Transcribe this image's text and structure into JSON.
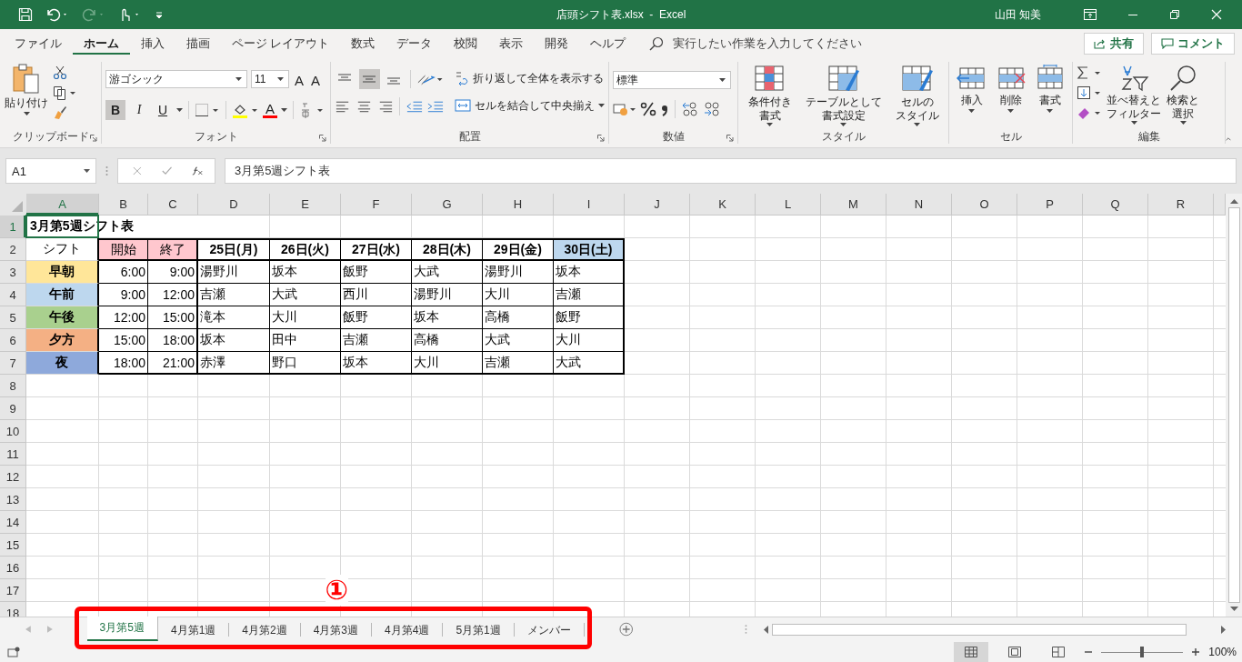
{
  "title_bar": {
    "title": "店頭シフト表.xlsx  -  Excel",
    "user": "山田 知美"
  },
  "menu_tabs": [
    {
      "label": "ファイル",
      "selected": false
    },
    {
      "label": "ホーム",
      "selected": true
    },
    {
      "label": "挿入",
      "selected": false
    },
    {
      "label": "描画",
      "selected": false
    },
    {
      "label": "ページ レイアウト",
      "selected": false
    },
    {
      "label": "数式",
      "selected": false
    },
    {
      "label": "データ",
      "selected": false
    },
    {
      "label": "校閲",
      "selected": false
    },
    {
      "label": "表示",
      "selected": false
    },
    {
      "label": "開発",
      "selected": false
    },
    {
      "label": "ヘルプ",
      "selected": false
    }
  ],
  "tell_me": {
    "placeholder": "実行したい作業を入力してください"
  },
  "share_button": "共有",
  "comment_button": "コメント",
  "ribbon": {
    "clipboard": {
      "paste": "貼り付け",
      "label": "クリップボード"
    },
    "font": {
      "name": "游ゴシック",
      "size": "11",
      "size_buttons": [
        "A",
        "A"
      ],
      "styles": [
        {
          "label": "B",
          "selected": true
        },
        {
          "label": "I",
          "selected": false
        },
        {
          "label": "U",
          "selected": false
        }
      ],
      "font_color": "A",
      "label": "フォント"
    },
    "alignment": {
      "vertical": [
        {
          "selected": false
        },
        {
          "selected": true
        },
        {
          "selected": false
        }
      ],
      "wrap": "折り返して全体を表示する",
      "merge": "セルを結合して中央揃え",
      "label": "配置"
    },
    "number": {
      "format": "標準",
      "label": "数値"
    },
    "styles": {
      "buttons": [
        {
          "lines": [
            "条件付き",
            "書式"
          ]
        },
        {
          "lines": [
            "テーブルとして",
            "書式設定"
          ]
        },
        {
          "lines": [
            "セルの",
            "スタイル"
          ]
        }
      ],
      "label": "スタイル"
    },
    "cells": {
      "buttons": [
        "挿入",
        "削除",
        "書式"
      ],
      "label": "セル"
    },
    "editing": {
      "buttons": [
        {
          "lines": [
            "並べ替えと",
            "フィルター"
          ]
        },
        {
          "lines": [
            "検索と",
            "選択"
          ]
        }
      ],
      "label": "編集"
    }
  },
  "formula_bar": {
    "name_box": "A1",
    "formula": "3月第5週シフト表"
  },
  "sheet": {
    "columns": [
      {
        "label": "A",
        "selected": true
      },
      {
        "label": "B",
        "selected": false
      },
      {
        "label": "C",
        "selected": false
      },
      {
        "label": "D",
        "selected": false
      },
      {
        "label": "E",
        "selected": false
      },
      {
        "label": "F",
        "selected": false
      },
      {
        "label": "G",
        "selected": false
      },
      {
        "label": "H",
        "selected": false
      },
      {
        "label": "I",
        "selected": false
      },
      {
        "label": "J",
        "selected": false
      },
      {
        "label": "K",
        "selected": false
      },
      {
        "label": "L",
        "selected": false
      },
      {
        "label": "M",
        "selected": false
      },
      {
        "label": "N",
        "selected": false
      },
      {
        "label": "O",
        "selected": false
      },
      {
        "label": "P",
        "selected": false
      },
      {
        "label": "Q",
        "selected": false
      },
      {
        "label": "R",
        "selected": false
      }
    ],
    "rows": [
      {
        "number": "1",
        "selected": true,
        "cells": [
          {
            "kind": "title",
            "text": "3月第5週シフト表"
          }
        ]
      },
      {
        "number": "2",
        "selected": false,
        "cells": [
          {
            "kind": "label",
            "text": "シフト"
          },
          {
            "kind": "time-header",
            "text": "開始",
            "color": "#ffc7ce"
          },
          {
            "kind": "time-header",
            "text": "終了",
            "color": "#ffc7ce"
          },
          {
            "kind": "day",
            "text": "25日(月)"
          },
          {
            "kind": "day",
            "text": "26日(火)"
          },
          {
            "kind": "day",
            "text": "27日(水)"
          },
          {
            "kind": "day",
            "text": "28日(木)"
          },
          {
            "kind": "day",
            "text": "29日(金)"
          },
          {
            "kind": "day",
            "text": "30日(土)",
            "color": "#bdd7ee"
          }
        ]
      },
      {
        "number": "3",
        "selected": false,
        "cells": [
          {
            "kind": "shift",
            "text": "早朝",
            "color": "#ffe699"
          },
          {
            "kind": "time",
            "text": "6:00"
          },
          {
            "kind": "time",
            "text": "9:00"
          },
          {
            "kind": "name",
            "text": "湯野川"
          },
          {
            "kind": "name",
            "text": "坂本"
          },
          {
            "kind": "name",
            "text": "飯野"
          },
          {
            "kind": "name",
            "text": "大武"
          },
          {
            "kind": "name",
            "text": "湯野川"
          },
          {
            "kind": "name",
            "text": "坂本"
          }
        ]
      },
      {
        "number": "4",
        "selected": false,
        "cells": [
          {
            "kind": "shift",
            "text": "午前",
            "color": "#bdd7ee"
          },
          {
            "kind": "time",
            "text": "9:00"
          },
          {
            "kind": "time",
            "text": "12:00"
          },
          {
            "kind": "name",
            "text": "吉瀬"
          },
          {
            "kind": "name",
            "text": "大武"
          },
          {
            "kind": "name",
            "text": "西川"
          },
          {
            "kind": "name",
            "text": "湯野川"
          },
          {
            "kind": "name",
            "text": "大川"
          },
          {
            "kind": "name",
            "text": "吉瀬"
          }
        ]
      },
      {
        "number": "5",
        "selected": false,
        "cells": [
          {
            "kind": "shift",
            "text": "午後",
            "color": "#a9d08e"
          },
          {
            "kind": "time",
            "text": "12:00"
          },
          {
            "kind": "time",
            "text": "15:00"
          },
          {
            "kind": "name",
            "text": "滝本"
          },
          {
            "kind": "name",
            "text": "大川"
          },
          {
            "kind": "name",
            "text": "飯野"
          },
          {
            "kind": "name",
            "text": "坂本"
          },
          {
            "kind": "name",
            "text": "高橋"
          },
          {
            "kind": "name",
            "text": "飯野"
          }
        ]
      },
      {
        "number": "6",
        "selected": false,
        "cells": [
          {
            "kind": "shift",
            "text": "夕方",
            "color": "#f4b084"
          },
          {
            "kind": "time",
            "text": "15:00"
          },
          {
            "kind": "time",
            "text": "18:00"
          },
          {
            "kind": "name",
            "text": "坂本"
          },
          {
            "kind": "name",
            "text": "田中"
          },
          {
            "kind": "name",
            "text": "吉瀬"
          },
          {
            "kind": "name",
            "text": "高橋"
          },
          {
            "kind": "name",
            "text": "大武"
          },
          {
            "kind": "name",
            "text": "大川"
          }
        ]
      },
      {
        "number": "7",
        "selected": false,
        "cells": [
          {
            "kind": "shift",
            "text": "夜",
            "color": "#8ea9db"
          },
          {
            "kind": "time",
            "text": "18:00"
          },
          {
            "kind": "time",
            "text": "21:00"
          },
          {
            "kind": "name",
            "text": "赤澤"
          },
          {
            "kind": "name",
            "text": "野口"
          },
          {
            "kind": "name",
            "text": "坂本"
          },
          {
            "kind": "name",
            "text": "大川"
          },
          {
            "kind": "name",
            "text": "吉瀬"
          },
          {
            "kind": "name",
            "text": "大武"
          }
        ]
      },
      {
        "number": "8",
        "selected": false
      },
      {
        "number": "9",
        "selected": false
      },
      {
        "number": "10",
        "selected": false
      },
      {
        "number": "11",
        "selected": false
      },
      {
        "number": "12",
        "selected": false
      },
      {
        "number": "13",
        "selected": false
      },
      {
        "number": "14",
        "selected": false
      },
      {
        "number": "15",
        "selected": false
      },
      {
        "number": "16",
        "selected": false
      },
      {
        "number": "17",
        "selected": false
      },
      {
        "number": "18",
        "selected": false
      }
    ]
  },
  "sheet_tabs": [
    {
      "label": "3月第5週",
      "selected": true
    },
    {
      "label": "4月第1週",
      "selected": false
    },
    {
      "label": "4月第2週",
      "selected": false
    },
    {
      "label": "4月第3週",
      "selected": false
    },
    {
      "label": "4月第4週",
      "selected": false
    },
    {
      "label": "5月第1週",
      "selected": false
    },
    {
      "label": "メンバー",
      "selected": false
    }
  ],
  "annotation": {
    "label": "①"
  },
  "status_bar": {
    "zoom": "100%",
    "level": 0.5
  }
}
